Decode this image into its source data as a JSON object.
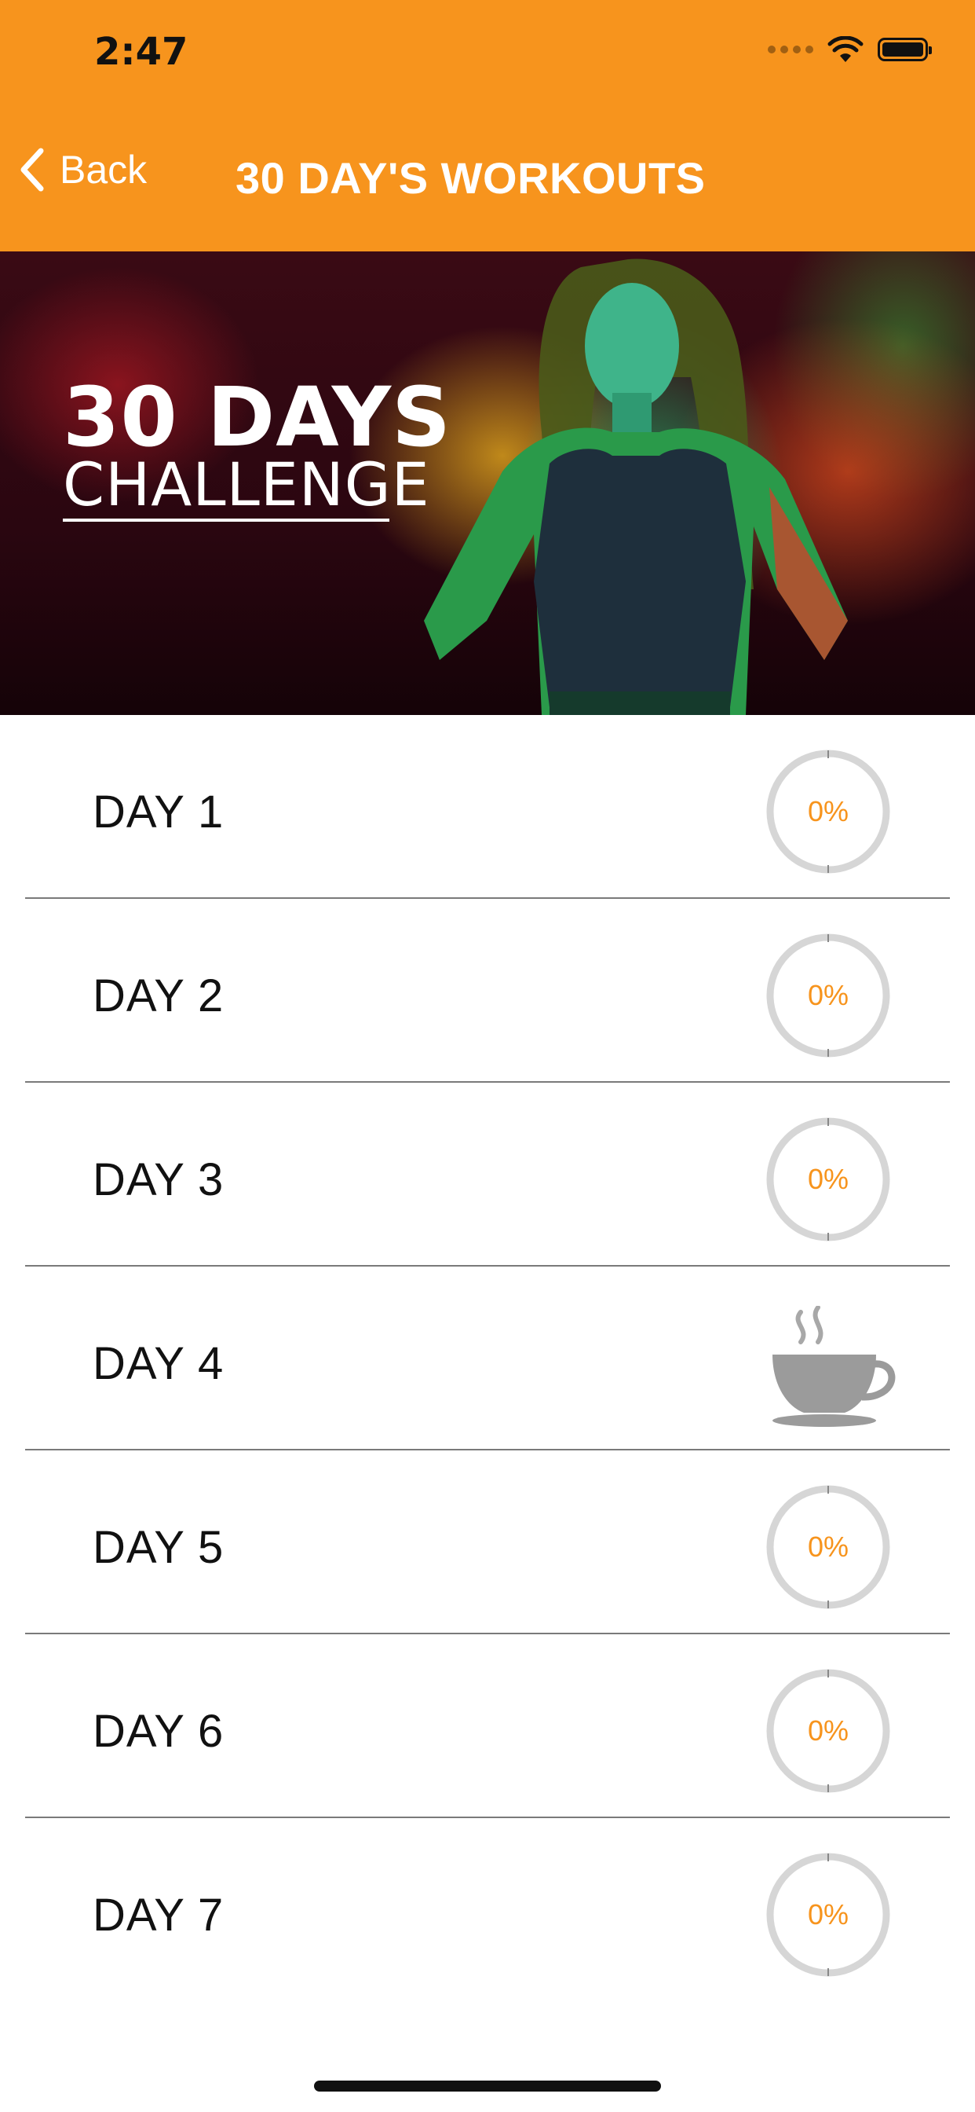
{
  "status_bar": {
    "time": "2:47"
  },
  "nav": {
    "back_label": "Back",
    "title": "30 DAY'S WORKOUTS"
  },
  "banner": {
    "title": "30 DAYS",
    "subtitle": "CHALLENGE"
  },
  "days": [
    {
      "label": "DAY  1",
      "type": "progress",
      "percent": 0,
      "percent_label": "0%"
    },
    {
      "label": "DAY  2",
      "type": "progress",
      "percent": 0,
      "percent_label": "0%"
    },
    {
      "label": "DAY  3",
      "type": "progress",
      "percent": 0,
      "percent_label": "0%"
    },
    {
      "label": "DAY  4",
      "type": "rest",
      "icon": "coffee-cup-icon"
    },
    {
      "label": "DAY  5",
      "type": "progress",
      "percent": 0,
      "percent_label": "0%"
    },
    {
      "label": "DAY  6",
      "type": "progress",
      "percent": 0,
      "percent_label": "0%"
    },
    {
      "label": "DAY  7",
      "type": "progress",
      "percent": 0,
      "percent_label": "0%"
    }
  ],
  "colors": {
    "accent": "#f7941d",
    "ring": "#d6d6d6",
    "separator": "#7a7a7a"
  }
}
